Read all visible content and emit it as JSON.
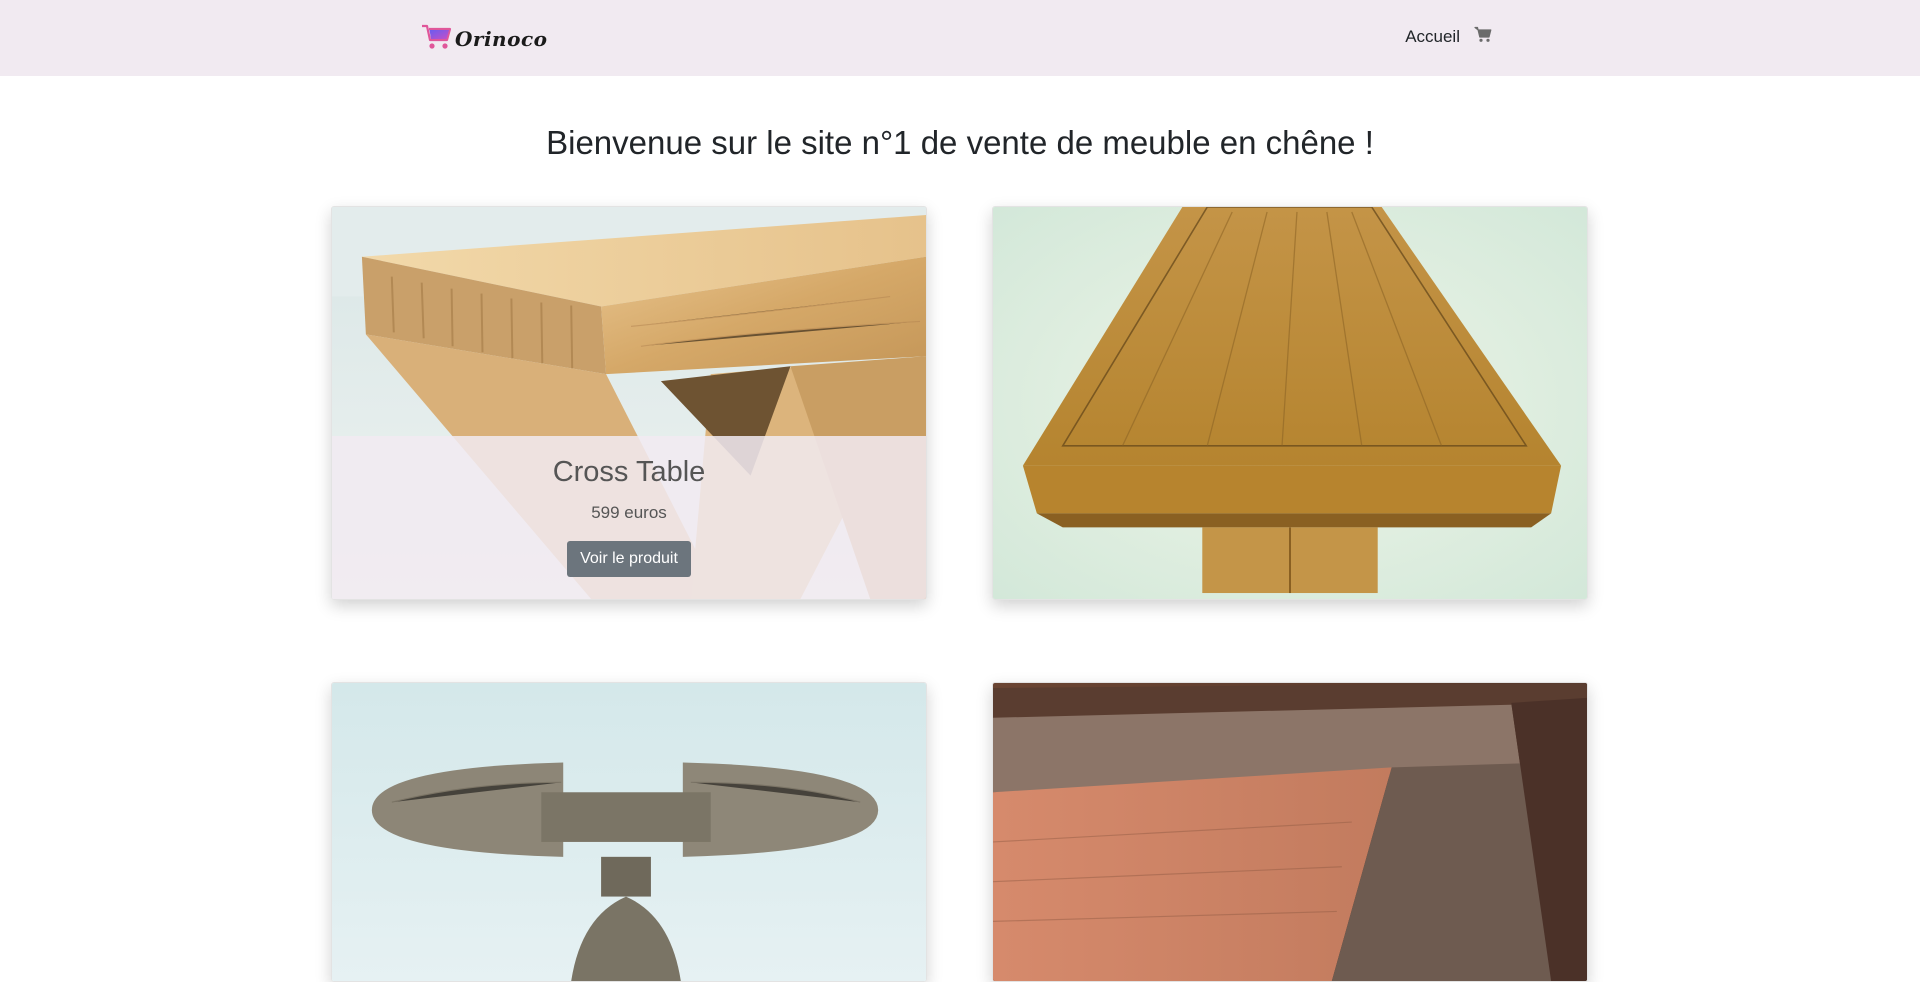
{
  "navbar": {
    "brand_text": "Orinoco",
    "links": [
      {
        "label": "Accueil"
      }
    ],
    "cart_icon": "shopping-cart-icon"
  },
  "main": {
    "heading": "Bienvenue sur le site n°1 de vente de meuble en chêne !"
  },
  "products": [
    {
      "name": "Cross Table",
      "price": "599 euros",
      "button_label": "Voir le produit"
    }
  ],
  "colors": {
    "navbar_bg": "#f1eaf1",
    "button_bg": "#6c757d",
    "brand_cart": "#8e4fd6"
  }
}
